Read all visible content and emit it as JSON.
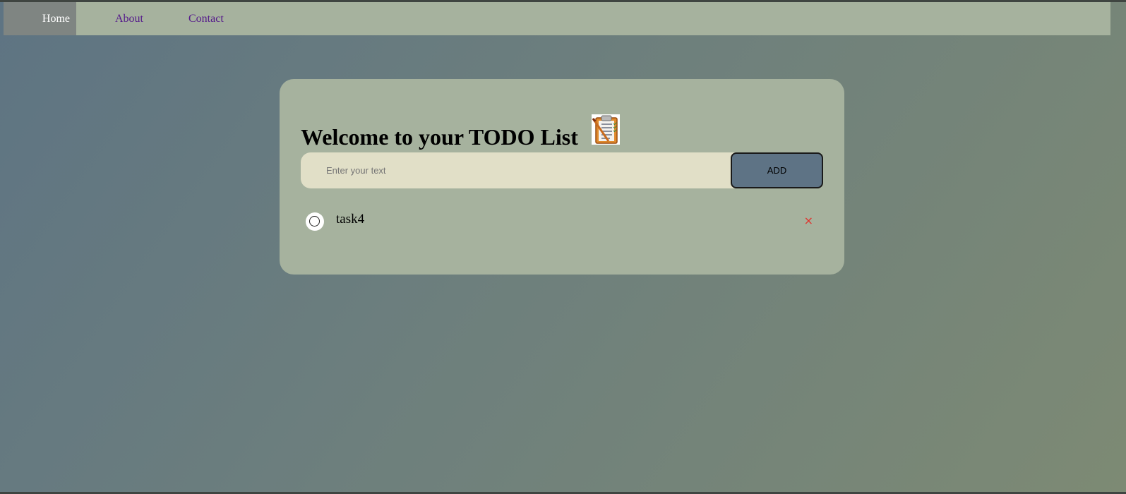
{
  "nav": {
    "items": [
      {
        "label": "Home",
        "active": true
      },
      {
        "label": "About",
        "active": false
      },
      {
        "label": "Contact",
        "active": false
      }
    ]
  },
  "main": {
    "title": "Welcome to your TODO List",
    "title_icon": "clipboard-checklist-icon",
    "input": {
      "placeholder": "Enter your text",
      "value": ""
    },
    "add_button_label": "ADD",
    "tasks": [
      {
        "text": "task4",
        "done": false,
        "delete_glyph": "×"
      }
    ]
  },
  "colors": {
    "card": "#a6b29e",
    "navbar": "#a6b29e",
    "nav_active": "#7f8582",
    "input_bg": "#e1dfc7",
    "add_button": "#5e7385",
    "delete": "#e0322c",
    "link": "#551a8b"
  }
}
